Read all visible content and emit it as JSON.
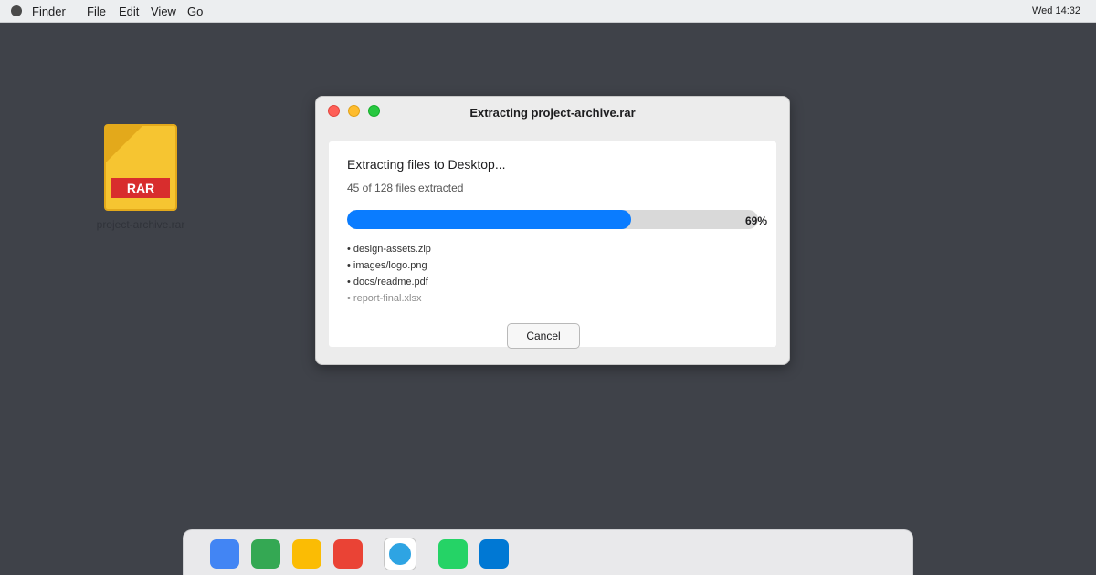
{
  "menubar": {
    "app_name": "Finder",
    "menus": [
      "File",
      "Edit",
      "View",
      "Go"
    ],
    "clock": "Wed 14:32"
  },
  "desktop": {
    "file_icon_badge": "RAR",
    "file_label": "project-archive.rar"
  },
  "dialog": {
    "title": "Extracting project-archive.rar",
    "heading": "Extracting files to Desktop...",
    "count_text": "45 of 128 files extracted",
    "progress_fraction": 0.69,
    "progress_label": "69%",
    "files": [
      {
        "name": "• design-assets.zip",
        "state": "done"
      },
      {
        "name": "• images/logo.png",
        "state": "done"
      },
      {
        "name": "• docs/readme.pdf",
        "state": "done"
      },
      {
        "name": "• report-final.xlsx",
        "state": "pending"
      }
    ],
    "cancel_label": "Cancel"
  },
  "dock": {
    "apps": [
      {
        "id": "app-blue",
        "color": "#4285f4",
        "active": false
      },
      {
        "id": "app-green",
        "color": "#34a853",
        "active": false
      },
      {
        "id": "app-yellow",
        "color": "#fbbc04",
        "active": false
      },
      {
        "id": "app-red",
        "color": "#ea4335",
        "active": false
      },
      {
        "id": "app-active",
        "color": "#2ea4e3",
        "active": true
      },
      {
        "id": "app-green-2",
        "color": "#25d366",
        "active": false
      },
      {
        "id": "app-blue-2",
        "color": "#0078d4",
        "active": false
      }
    ]
  },
  "colors": {
    "accent": "#0a7cff",
    "desktop_bg": "#3f4249"
  }
}
